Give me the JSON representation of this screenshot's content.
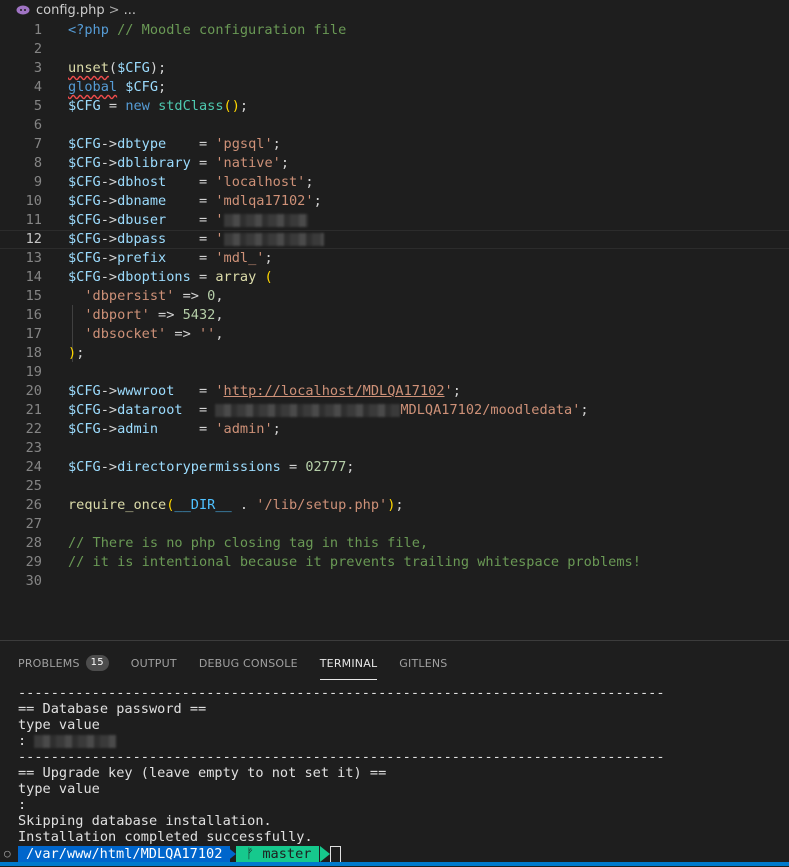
{
  "breadcrumb": {
    "file": "config.php",
    "separator": ">",
    "trail": "..."
  },
  "editor": {
    "lines": [
      {
        "n": "1",
        "tokens": [
          [
            "kw",
            "<?php"
          ],
          [
            "plain",
            " "
          ],
          [
            "cmt",
            "// Moodle configuration file"
          ]
        ]
      },
      {
        "n": "2",
        "tokens": []
      },
      {
        "n": "3",
        "tokens": [
          [
            "fn",
            "unset"
          ],
          [
            "plain",
            "("
          ],
          [
            "var",
            "$CFG"
          ],
          [
            "plain",
            ");"
          ]
        ]
      },
      {
        "n": "4",
        "tokens": [
          [
            "kw",
            "global"
          ],
          [
            "plain",
            " "
          ],
          [
            "var",
            "$CFG"
          ],
          [
            "plain",
            ";"
          ]
        ]
      },
      {
        "n": "5",
        "tokens": [
          [
            "var",
            "$CFG"
          ],
          [
            "plain",
            " = "
          ],
          [
            "kw",
            "new"
          ],
          [
            "plain",
            " "
          ],
          [
            "cls",
            "stdClass"
          ],
          [
            "br",
            "()"
          ],
          [
            "plain",
            ";"
          ]
        ]
      },
      {
        "n": "6",
        "tokens": []
      },
      {
        "n": "7",
        "tokens": [
          [
            "var",
            "$CFG"
          ],
          [
            "plain",
            "->"
          ],
          [
            "prop",
            "dbtype"
          ],
          [
            "plain",
            "    = "
          ],
          [
            "str",
            "'pgsql'"
          ],
          [
            "plain",
            ";"
          ]
        ]
      },
      {
        "n": "8",
        "tokens": [
          [
            "var",
            "$CFG"
          ],
          [
            "plain",
            "->"
          ],
          [
            "prop",
            "dblibrary"
          ],
          [
            "plain",
            " = "
          ],
          [
            "str",
            "'native'"
          ],
          [
            "plain",
            ";"
          ]
        ]
      },
      {
        "n": "9",
        "tokens": [
          [
            "var",
            "$CFG"
          ],
          [
            "plain",
            "->"
          ],
          [
            "prop",
            "dbhost"
          ],
          [
            "plain",
            "    = "
          ],
          [
            "str",
            "'localhost'"
          ],
          [
            "plain",
            ";"
          ]
        ]
      },
      {
        "n": "10",
        "tokens": [
          [
            "var",
            "$CFG"
          ],
          [
            "plain",
            "->"
          ],
          [
            "prop",
            "dbname"
          ],
          [
            "plain",
            "    = "
          ],
          [
            "str",
            "'mdlqa17102'"
          ],
          [
            "plain",
            ";"
          ]
        ]
      },
      {
        "n": "11",
        "tokens": [
          [
            "var",
            "$CFG"
          ],
          [
            "plain",
            "->"
          ],
          [
            "prop",
            "dbuser"
          ],
          [
            "plain",
            "    = "
          ],
          [
            "str",
            "'"
          ],
          [
            "blur",
            "84"
          ]
        ]
      },
      {
        "n": "12",
        "tokens": [
          [
            "var",
            "$CFG"
          ],
          [
            "plain",
            "->"
          ],
          [
            "prop",
            "dbpass"
          ],
          [
            "plain",
            "    = "
          ],
          [
            "str",
            "'"
          ],
          [
            "blur",
            "100"
          ]
        ]
      },
      {
        "n": "13",
        "tokens": [
          [
            "var",
            "$CFG"
          ],
          [
            "plain",
            "->"
          ],
          [
            "prop",
            "prefix"
          ],
          [
            "plain",
            "    = "
          ],
          [
            "str",
            "'mdl_'"
          ],
          [
            "plain",
            ";"
          ]
        ]
      },
      {
        "n": "14",
        "tokens": [
          [
            "var",
            "$CFG"
          ],
          [
            "plain",
            "->"
          ],
          [
            "prop",
            "dboptions"
          ],
          [
            "plain",
            " = "
          ],
          [
            "fn",
            "array"
          ],
          [
            "plain",
            " "
          ],
          [
            "br",
            "("
          ]
        ]
      },
      {
        "n": "15",
        "tokens": [
          [
            "plain",
            "  "
          ],
          [
            "str",
            "'dbpersist'"
          ],
          [
            "plain",
            " => "
          ],
          [
            "num",
            "0"
          ],
          [
            "plain",
            ","
          ]
        ]
      },
      {
        "n": "16",
        "tokens": [
          [
            "plain",
            "  "
          ],
          [
            "str",
            "'dbport'"
          ],
          [
            "plain",
            " => "
          ],
          [
            "num",
            "5432"
          ],
          [
            "plain",
            ","
          ]
        ]
      },
      {
        "n": "17",
        "tokens": [
          [
            "plain",
            "  "
          ],
          [
            "str",
            "'dbsocket'"
          ],
          [
            "plain",
            " => "
          ],
          [
            "str",
            "''"
          ],
          [
            "plain",
            ","
          ]
        ]
      },
      {
        "n": "18",
        "tokens": [
          [
            "br",
            ")"
          ],
          [
            "plain",
            ";"
          ]
        ]
      },
      {
        "n": "19",
        "tokens": []
      },
      {
        "n": "20",
        "tokens": [
          [
            "var",
            "$CFG"
          ],
          [
            "plain",
            "->"
          ],
          [
            "prop",
            "wwwroot"
          ],
          [
            "plain",
            "   = "
          ],
          [
            "str",
            "'"
          ],
          [
            "link",
            "http://localhost/MDLQA17102"
          ],
          [
            "str",
            "'"
          ],
          [
            "plain",
            ";"
          ]
        ]
      },
      {
        "n": "21",
        "tokens": [
          [
            "var",
            "$CFG"
          ],
          [
            "plain",
            "->"
          ],
          [
            "prop",
            "dataroot"
          ],
          [
            "plain",
            "  = "
          ],
          [
            "blur",
            "185"
          ],
          [
            "str",
            "MDLQA17102/moodledata'"
          ],
          [
            "plain",
            ";"
          ]
        ]
      },
      {
        "n": "22",
        "tokens": [
          [
            "var",
            "$CFG"
          ],
          [
            "plain",
            "->"
          ],
          [
            "prop",
            "admin"
          ],
          [
            "plain",
            "     = "
          ],
          [
            "str",
            "'admin'"
          ],
          [
            "plain",
            ";"
          ]
        ]
      },
      {
        "n": "23",
        "tokens": []
      },
      {
        "n": "24",
        "tokens": [
          [
            "var",
            "$CFG"
          ],
          [
            "plain",
            "->"
          ],
          [
            "prop",
            "directorypermissions"
          ],
          [
            "plain",
            " = "
          ],
          [
            "num",
            "02777"
          ],
          [
            "plain",
            ";"
          ]
        ]
      },
      {
        "n": "25",
        "tokens": []
      },
      {
        "n": "26",
        "tokens": [
          [
            "fn",
            "require_once"
          ],
          [
            "br",
            "("
          ],
          [
            "const",
            "__DIR__"
          ],
          [
            "plain",
            " . "
          ],
          [
            "str",
            "'/lib/setup.php'"
          ],
          [
            "br",
            ")"
          ],
          [
            "plain",
            ";"
          ]
        ]
      },
      {
        "n": "27",
        "tokens": []
      },
      {
        "n": "28",
        "tokens": [
          [
            "cmt",
            "// There is no php closing tag in this file,"
          ]
        ]
      },
      {
        "n": "29",
        "tokens": [
          [
            "cmt",
            "// it is intentional because it prevents trailing whitespace problems!"
          ]
        ]
      },
      {
        "n": "30",
        "tokens": []
      }
    ]
  },
  "panel": {
    "tabs": [
      {
        "label": "PROBLEMS",
        "badge": "15",
        "active": false
      },
      {
        "label": "OUTPUT",
        "active": false
      },
      {
        "label": "DEBUG CONSOLE",
        "active": false
      },
      {
        "label": "TERMINAL",
        "active": true
      },
      {
        "label": "GITLENS",
        "active": false
      }
    ]
  },
  "terminal": {
    "lines": [
      "-------------------------------------------------------------------------------",
      "== Database password ==",
      "type value",
      ": ",
      "-------------------------------------------------------------------------------",
      "== Upgrade key (leave empty to not set it) ==",
      "type value",
      ":",
      "Skipping database installation.",
      "Installation completed successfully."
    ],
    "prompt": {
      "path": "/var/www/html/MDLQA17102",
      "branch": "master",
      "branch_icon": "git-branch-icon"
    }
  },
  "colors": {
    "accent": "#007acc",
    "prompt_path_bg": "#0066cc",
    "prompt_branch_bg": "#16c98d"
  }
}
